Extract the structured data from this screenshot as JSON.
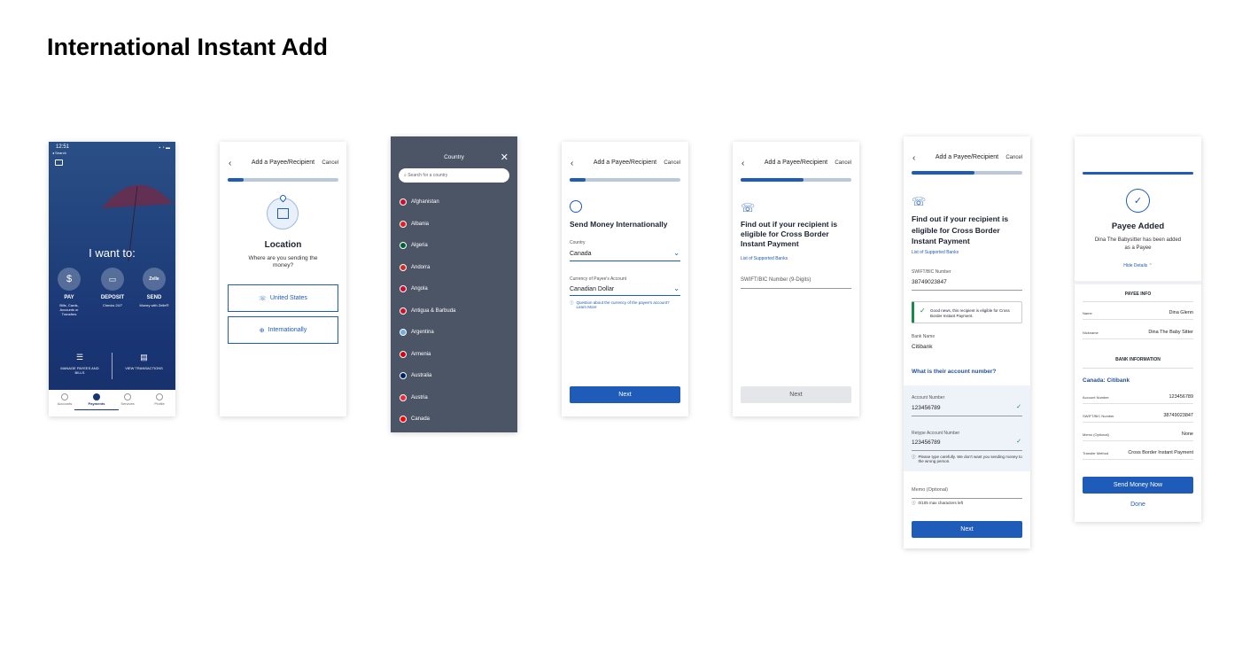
{
  "page_title": "International Instant Add",
  "screen1": {
    "time": "12:51",
    "status_back": "◂ Search",
    "heading": "I want to:",
    "actions": [
      {
        "label": "PAY",
        "sub": "Bills, Cards, Accounts or Transfers"
      },
      {
        "label": "DEPOSIT",
        "sub": "Checks 24/7"
      },
      {
        "label": "SEND",
        "sub": "Money with Zelle®",
        "badge": "Zelle"
      }
    ],
    "manage": "MANAGE PAYEES AND BILLS",
    "view": "VIEW TRANSACTIONS",
    "tabs": [
      "Accounts",
      "Payments",
      "Services",
      "Profile"
    ]
  },
  "screen2": {
    "header": "Add a Payee/Recipient",
    "cancel": "Cancel",
    "heading": "Location",
    "sub": "Where are you sending the money?",
    "opt_us": "United States",
    "opt_intl": "Internationally"
  },
  "screen3": {
    "header": "Country",
    "search_placeholder": "Search for a country",
    "countries": [
      "Afghanistan",
      "Albania",
      "Algeria",
      "Andorra",
      "Angola",
      "Antigua & Barbuda",
      "Argentina",
      "Armenia",
      "Australia",
      "Austria",
      "Canada"
    ],
    "flag_colors": [
      "#c8102e",
      "#e41e20",
      "#006233",
      "#d52b1e",
      "#cc092f",
      "#ce1126",
      "#74acdf",
      "#d90012",
      "#012169",
      "#ed2939",
      "#ff0000"
    ]
  },
  "screen4": {
    "header": "Add a Payee/Recipient",
    "cancel": "Cancel",
    "heading": "Send Money Internationally",
    "country_label": "Country",
    "country_value": "Canada",
    "currency_label": "Currency of Payee's Account",
    "currency_value": "Canadian Dollar",
    "question": "Question about the currency of the payee's account? Learn More",
    "next": "Next"
  },
  "screen5": {
    "header": "Add a Payee/Recipient",
    "cancel": "Cancel",
    "heading": "Find out if your recipient is eligible for Cross Border Instant Payment",
    "link": "List of Supported Banks",
    "swift_placeholder": "SWIFT/BIC Number (9-Digits)",
    "next": "Next"
  },
  "screen6": {
    "header": "Add a Payee/Recipient",
    "cancel": "Cancel",
    "heading": "Find out if your recipient is eligible for Cross Border Instant Payment",
    "link": "List of Supported Banks",
    "swift_label": "SWIFT/BIC Number",
    "swift_value": "38749023847",
    "good_news": "Good news, this recipient is eligible for Cross Border Instant Payment.",
    "bank_label": "Bank Name",
    "bank_value": "Citibank",
    "acct_q": "What is their account number?",
    "acct_label": "Account Number",
    "acct_value": "123456789",
    "retype_label": "Retype Account Number",
    "retype_value": "123456789",
    "warning": "Please type carefully. We don't want you sending money to the wrong person.",
    "memo_placeholder": "Memo (Optional)",
    "memo_hint": "0/105 max characters left",
    "next": "Next"
  },
  "screen7": {
    "heading": "Payee Added",
    "sub": "Dina The Babysitter has been added as a Payee",
    "hide": "Hide Details",
    "payee_info": "PAYEE INFO",
    "name_k": "Name",
    "name_v": "Dina Glenn",
    "nick_k": "Nickname",
    "nick_v": "Dina The Baby Sitter",
    "bank_info": "BANK INFORMATION",
    "bank_title": "Canada: Citibank",
    "acct_k": "Account Number",
    "acct_v": "123456789",
    "swift_k": "SWIFT/BIC Number",
    "swift_v": "38749023847",
    "memo_k": "Memo (Optional)",
    "memo_v": "None",
    "method_k": "Transfer Method",
    "method_v": "Cross Border Instant Payment",
    "send": "Send Money Now",
    "done": "Done"
  },
  "colors": {
    "accent": "#1f5bb8",
    "track": "#b9c8db",
    "dark_panel": "#4b5566"
  }
}
